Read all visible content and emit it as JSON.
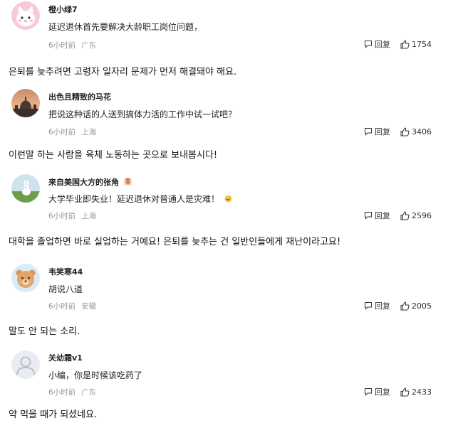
{
  "comments": [
    {
      "username": "橙小绿7",
      "content": "延迟退休首先要解决大龄职工岗位问题，",
      "time": "6小时前",
      "location": "广东",
      "reply_label": "回复",
      "likes": "1754",
      "translation": "은퇴를 늦추려면 고령자 일자리 문제가 먼저 해결돼야 해요.",
      "avatar_icon": "pink-cat-avatar"
    },
    {
      "username": "出色且精致的马花",
      "content": "把说这种话的人送到搞体力活的工作中试一试吧？",
      "time": "6小时前",
      "location": "上海",
      "reply_label": "回复",
      "likes": "3406",
      "translation": "이런말 하는 사람을 육체 노동하는 곳으로 보내봅시다!",
      "avatar_icon": "sunset-cathedral-avatar"
    },
    {
      "username": "来自美国大方的张角",
      "badge_icon": "medal-badge-icon",
      "content": "大学毕业即失业！延迟退休对普通人是灾难！",
      "content_emoji": "laughing-emoji-icon",
      "time": "6小时前",
      "location": "上海",
      "reply_label": "回复",
      "likes": "2596",
      "translation": "대학을 졸업하면 바로 실업하는 거예요! 은퇴를 늦추는 건 일반인들에게 재난이라고요!",
      "avatar_icon": "rabbit-meadow-avatar"
    },
    {
      "username": "韦笑寒44",
      "content": "胡说八道",
      "time": "6小时前",
      "location": "安徽",
      "reply_label": "回复",
      "likes": "2005",
      "translation": "말도 안 되는 소리.",
      "avatar_icon": "bear-avatar"
    },
    {
      "username": "关幼霜v1",
      "content": "小编，你是时候该吃药了",
      "time": "6小时前",
      "location": "广东",
      "reply_label": "回复",
      "likes": "2433",
      "translation": "약 먹을 때가 되셨네요.",
      "avatar_icon": "default-user-avatar"
    }
  ],
  "colors": {
    "text": "#222222",
    "meta": "#999999",
    "background": "#ffffff"
  }
}
